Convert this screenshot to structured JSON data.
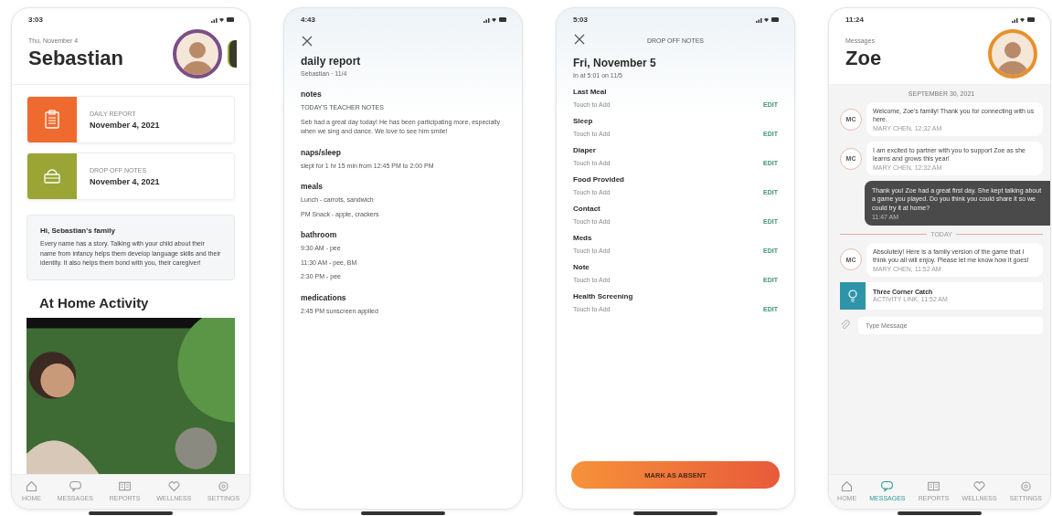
{
  "screens": [
    {
      "kind": "home",
      "time": "3:03",
      "date": "Thu, November 4",
      "name": "Sebastian",
      "cards": [
        {
          "label": "DAILY REPORT",
          "date": "November 4, 2021",
          "color": "#ef6a2e"
        },
        {
          "label": "DROP OFF NOTES",
          "date": "November 4, 2021",
          "color": "#9aa536"
        }
      ],
      "note": {
        "title": "Hi, Sebastian's family",
        "body": "Every name has a story. Talking with your child about their name from infancy helps them develop language skills and their identity. It also helps them bond with you, their caregiver!"
      },
      "activity_title": "At Home Activity",
      "tabs": [
        {
          "label": "HOME",
          "selected": false
        },
        {
          "label": "MESSAGES",
          "selected": false
        },
        {
          "label": "REPORTS",
          "selected": false
        },
        {
          "label": "WELLNESS",
          "selected": false
        },
        {
          "label": "SETTINGS",
          "selected": false
        }
      ]
    },
    {
      "kind": "report",
      "time": "4:43",
      "title": "daily report",
      "subtitle": "Sebastian · 11/4",
      "sections": [
        {
          "heading": "notes",
          "lines": [
            "TODAY'S TEACHER NOTES",
            "Seb had a great day today! He has been participating more, especially when we sing and dance. We love to see him smile!"
          ]
        },
        {
          "heading": "naps/sleep",
          "lines": [
            "slept for 1 hr 15 min from 12:45 PM to 2:00 PM"
          ]
        },
        {
          "heading": "meals",
          "lines": [
            "Lunch - carrots, sandwich",
            "PM Snack - apple, crackers"
          ]
        },
        {
          "heading": "bathroom",
          "lines": [
            "9:30 AM - pee",
            "11:30 AM - pee, BM",
            "2:30 PM - pee"
          ]
        },
        {
          "heading": "medications",
          "lines": [
            "2:45 PM sunscreen applied"
          ]
        }
      ]
    },
    {
      "kind": "dropoff",
      "time": "5:03",
      "header": "DROP OFF NOTES",
      "title": "Fri, November 5",
      "subtitle": "In at 5:01 on 11/5",
      "items": [
        {
          "label": "Last Meal",
          "hint": "Touch to Add",
          "action": "EDIT"
        },
        {
          "label": "Sleep",
          "hint": "Touch to Add",
          "action": "EDIT"
        },
        {
          "label": "Diaper",
          "hint": "Touch to Add",
          "action": "EDIT"
        },
        {
          "label": "Food Provided",
          "hint": "Touch to Add",
          "action": "EDIT"
        },
        {
          "label": "Contact",
          "hint": "Touch to Add",
          "action": "EDIT"
        },
        {
          "label": "Meds",
          "hint": "Touch to Add",
          "action": "EDIT"
        },
        {
          "label": "Note",
          "hint": "Touch to Add",
          "action": "EDIT"
        },
        {
          "label": "Health Screening",
          "hint": "Touch to Add",
          "action": "EDIT"
        }
      ],
      "button": "MARK AS ABSENT"
    },
    {
      "kind": "messages",
      "time": "11:24",
      "caption": "Messages",
      "name": "Zoe",
      "date_label": "SEPTEMBER 30, 2021",
      "messages": [
        {
          "kind": "incoming",
          "initials": "MC",
          "text": "Welcome, Zoe's family! Thank you for connecting with us here.",
          "meta": "MARY CHEN, 12:32 AM"
        },
        {
          "kind": "incoming",
          "initials": "MC",
          "text": "I am excited to partner with you to support Zoe as she learns and grows this year!",
          "meta": "MARY CHEN, 12:32 AM"
        },
        {
          "kind": "outgoing",
          "text": "Thank you! Zoe had a great first day. She kept talking about a game you played. Do you think you could share it so we could try it at home?",
          "meta": "11:47 AM"
        },
        {
          "kind": "divider",
          "text": "TODAY"
        },
        {
          "kind": "incoming",
          "initials": "MC",
          "text": "Absolutely! Here is a family version of the game that I think you all will enjoy. Please let me know how it goes!",
          "meta": "MARY CHEN, 11:52 AM"
        },
        {
          "kind": "attachment",
          "title": "Three Corner Catch",
          "meta": "ACTIVITY LINK, 11:52 AM"
        }
      ],
      "input": {
        "placeholder": "Type Message"
      },
      "tabs": [
        {
          "label": "HOME",
          "selected": false
        },
        {
          "label": "MESSAGES",
          "selected": true
        },
        {
          "label": "REPORTS",
          "selected": false
        },
        {
          "label": "WELLNESS",
          "selected": false
        },
        {
          "label": "SETTINGS",
          "selected": false
        }
      ]
    }
  ]
}
